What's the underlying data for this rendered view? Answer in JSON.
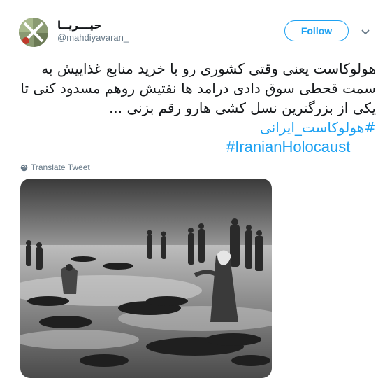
{
  "user": {
    "display_name": "حیـــریــا",
    "handle": "@mahdiyavaran_"
  },
  "actions": {
    "follow_label": "Follow",
    "more_icon": "chevron-down-icon"
  },
  "tweet": {
    "lines": [
      "هولوکاست یعنی وقتی کشوری رو با خرید منابع غذاییش به",
      "سمت قحطی سوق دادی درامد ها نفتیش روهم مسدود کنی تا",
      "یکی از بزرگترین نسل کشی هارو رقم بزنی ..."
    ],
    "hashtag_fa": "#هولوکاست_ایرانی",
    "hashtag_en": "#IranianHolocaust"
  },
  "translate": {
    "icon": "globe-icon",
    "label": "Translate Tweet"
  },
  "media": {
    "type": "black-and-white photograph"
  },
  "colors": {
    "accent": "#1da1f2",
    "text": "#14171a",
    "muted": "#657786"
  }
}
